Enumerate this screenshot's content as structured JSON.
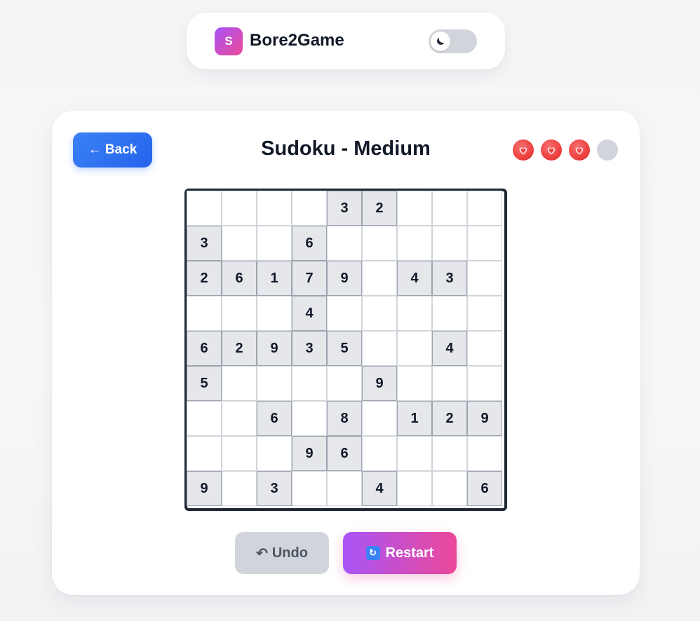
{
  "header": {
    "logo_letter": "S",
    "brand": "Bore2Game",
    "theme_toggle_icon": "moon-icon"
  },
  "game": {
    "back_label": "← Back",
    "title": "Sudoku - Medium",
    "lives": {
      "total": 4,
      "remaining": 3,
      "icon": "heart-icon"
    },
    "grid": [
      [
        null,
        null,
        null,
        null,
        3,
        2,
        null,
        null,
        null
      ],
      [
        3,
        null,
        null,
        6,
        null,
        null,
        null,
        null,
        null
      ],
      [
        2,
        6,
        1,
        7,
        9,
        null,
        4,
        3,
        null
      ],
      [
        null,
        null,
        null,
        4,
        null,
        null,
        null,
        null,
        null
      ],
      [
        6,
        2,
        9,
        3,
        5,
        null,
        null,
        4,
        null
      ],
      [
        5,
        null,
        null,
        null,
        null,
        9,
        null,
        null,
        null
      ],
      [
        null,
        null,
        6,
        null,
        8,
        null,
        1,
        2,
        9
      ],
      [
        null,
        null,
        null,
        9,
        6,
        null,
        null,
        null,
        null
      ],
      [
        9,
        null,
        3,
        null,
        null,
        4,
        null,
        null,
        6
      ]
    ],
    "undo_label": "Undo",
    "undo_icon": "↶",
    "restart_label": "Restart",
    "restart_icon": "🔄"
  },
  "colors": {
    "accent_blue": "#2563eb",
    "accent_pink": "#ec4899",
    "accent_purple": "#a855f7",
    "heart_red": "#ef4444",
    "given_cell": "#e5e7eb"
  }
}
